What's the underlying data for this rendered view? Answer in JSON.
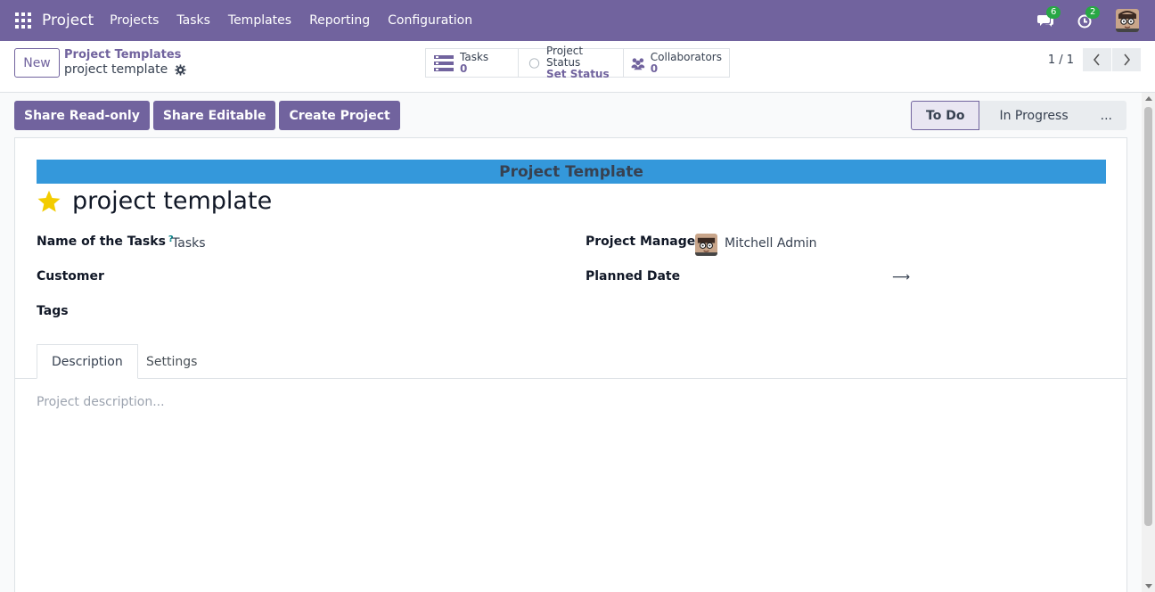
{
  "navbar": {
    "app_name": "Project",
    "menu": [
      "Projects",
      "Tasks",
      "Templates",
      "Reporting",
      "Configuration"
    ],
    "messages_count": "6",
    "activities_count": "2"
  },
  "control": {
    "new_label": "New",
    "breadcrumb": "Project Templates",
    "record_name": "project template",
    "smart_buttons": {
      "tasks_label": "Tasks",
      "tasks_value": "0",
      "status_label": "Project Status",
      "status_value": "Set Status",
      "collab_label": "Collaborators",
      "collab_value": "0"
    },
    "pager": "1 / 1"
  },
  "actions": {
    "share_readonly": "Share Read-only",
    "share_editable": "Share Editable",
    "create_project": "Create Project"
  },
  "stages": {
    "todo": "To Do",
    "in_progress": "In Progress",
    "more": "..."
  },
  "form": {
    "ribbon": "Project Template",
    "title": "project template",
    "name_of_tasks_label": "Name of the Tasks",
    "name_of_tasks_help": "?",
    "name_of_tasks_value": "Tasks",
    "customer_label": "Customer",
    "tags_label": "Tags",
    "project_manager_label": "Project Manager",
    "project_manager_value": "Mitchell Admin",
    "planned_date_label": "Planned Date",
    "planned_date_arrow": "⟶",
    "tabs": [
      "Description",
      "Settings"
    ],
    "description_placeholder": "Project description..."
  },
  "colors": {
    "brand": "#71639e",
    "ribbon": "#3498db",
    "star": "#f3cc00",
    "badge": "#28a745"
  }
}
